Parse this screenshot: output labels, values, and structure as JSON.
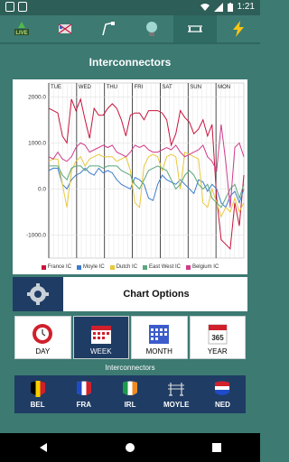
{
  "status": {
    "time": "1:21"
  },
  "toolbar": {
    "items": [
      {
        "name": "live-icon",
        "label": "LIVE"
      },
      {
        "name": "pylon-icon"
      },
      {
        "name": "wind-icon"
      },
      {
        "name": "bulb-icon"
      },
      {
        "name": "interconnector-icon"
      },
      {
        "name": "lightning-icon"
      }
    ],
    "active_index": 4
  },
  "page_title": "Interconnectors",
  "chart_data": {
    "type": "line",
    "categories": [
      "TUE",
      "WED",
      "THU",
      "FRI",
      "SAT",
      "SUN",
      "MON"
    ],
    "y_ticks": [
      "2000.0",
      "1000.0",
      "0.0",
      "-1000.0"
    ],
    "ylim": [
      -1500,
      2300
    ],
    "grid": true,
    "legend_position": "bottom",
    "series": [
      {
        "name": "France IC",
        "color": "#c8143c",
        "values": [
          1750,
          1700,
          1650,
          1150,
          1000,
          1950,
          1700,
          1950,
          1500,
          1100,
          1750,
          1600,
          1600,
          1750,
          1850,
          1750,
          1500,
          1150,
          1600,
          1650,
          1650,
          1500,
          1700,
          1700,
          1700,
          1650,
          1500,
          950,
          1200,
          1700,
          1550,
          1450,
          1200,
          1300,
          1500,
          1150,
          1400,
          -200,
          -1100,
          -1200,
          -1300,
          -300,
          -800,
          300
        ]
      },
      {
        "name": "Moyle IC",
        "color": "#3c7ccc",
        "values": [
          400,
          450,
          450,
          100,
          0,
          200,
          300,
          350,
          450,
          350,
          300,
          450,
          350,
          400,
          350,
          200,
          100,
          50,
          0,
          250,
          200,
          100,
          -200,
          -250,
          100,
          300,
          200,
          150,
          100,
          200,
          100,
          0,
          -100,
          200,
          150,
          -50,
          100,
          0,
          -300,
          -400,
          -150,
          -50,
          -300,
          0
        ]
      },
      {
        "name": "Dutch IC",
        "color": "#e8c83c",
        "values": [
          600,
          650,
          650,
          100,
          -400,
          400,
          600,
          700,
          500,
          650,
          700,
          750,
          700,
          700,
          700,
          600,
          650,
          700,
          400,
          -300,
          -400,
          500,
          700,
          750,
          700,
          400,
          700,
          750,
          700,
          0,
          800,
          750,
          700,
          650,
          -300,
          -400,
          0,
          -300,
          -600,
          -400,
          -500,
          -200,
          -500,
          -300
        ]
      },
      {
        "name": "East West IC",
        "color": "#5aa87c",
        "values": [
          500,
          500,
          500,
          300,
          200,
          450,
          500,
          500,
          400,
          500,
          500,
          500,
          450,
          500,
          500,
          500,
          400,
          350,
          300,
          100,
          0,
          200,
          400,
          450,
          500,
          450,
          400,
          200,
          0,
          100,
          300,
          400,
          300,
          100,
          0,
          100,
          -200,
          -300,
          -400,
          -200,
          0,
          100,
          -200,
          100
        ]
      },
      {
        "name": "Belgium IC",
        "color": "#d03c8c",
        "values": [
          700,
          650,
          800,
          650,
          600,
          700,
          900,
          1000,
          950,
          800,
          850,
          900,
          950,
          900,
          950,
          800,
          750,
          700,
          800,
          950,
          900,
          950,
          850,
          800,
          800,
          850,
          900,
          850,
          950,
          800,
          700,
          750,
          800,
          850,
          950,
          700,
          600,
          400,
          1400,
          600,
          -400,
          900,
          1000,
          700
        ]
      }
    ]
  },
  "chart_options": {
    "label": "Chart Options"
  },
  "periods": [
    {
      "name": "day",
      "label": "DAY"
    },
    {
      "name": "week",
      "label": "WEEK"
    },
    {
      "name": "month",
      "label": "MONTH"
    },
    {
      "name": "year",
      "label": "YEAR",
      "badge": "365"
    }
  ],
  "active_period": 1,
  "ic_section_label": "Interconnectors",
  "interconnectors": [
    {
      "label": "BEL",
      "flag": "bel"
    },
    {
      "label": "FRA",
      "flag": "fra"
    },
    {
      "label": "IRL",
      "flag": "irl"
    },
    {
      "label": "MOYLE",
      "flag": "pylon"
    },
    {
      "label": "NED",
      "flag": "ned"
    }
  ],
  "colors": {
    "brand": "#3c7a72",
    "accent_dark": "#1f3c64"
  }
}
